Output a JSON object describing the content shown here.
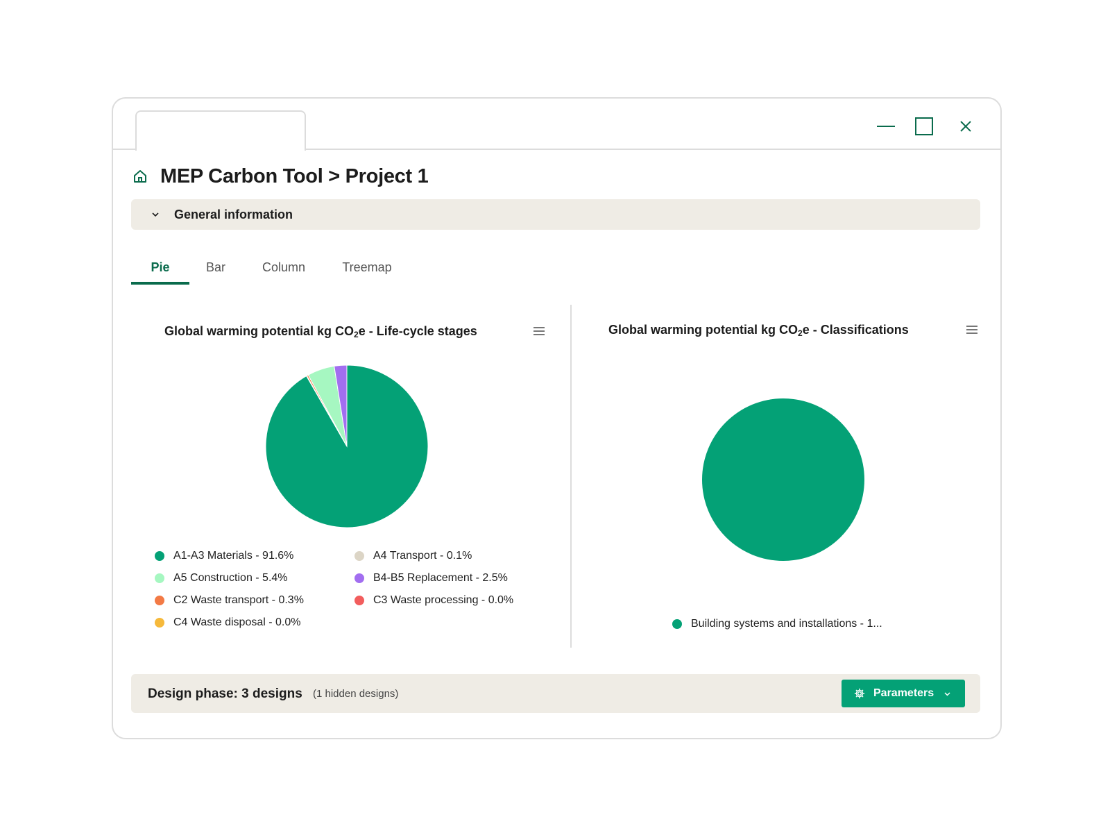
{
  "header": {
    "breadcrumb_title": "MEP Carbon Tool > Project 1"
  },
  "general_section": {
    "label": "General information",
    "expanded": false
  },
  "tabs": [
    {
      "label": "Pie",
      "active": true
    },
    {
      "label": "Bar",
      "active": false
    },
    {
      "label": "Column",
      "active": false
    },
    {
      "label": "Treemap",
      "active": false
    }
  ],
  "charts": {
    "left": {
      "title_prefix": "Global warming potential kg CO",
      "title_sub": "2",
      "title_suffix": "e - Life-cycle stages"
    },
    "right": {
      "title_prefix": "Global warming potential kg CO",
      "title_sub": "2",
      "title_suffix": "e - Classifications"
    }
  },
  "chart_data": [
    {
      "type": "pie",
      "title": "Global warming potential kg CO2e - Life-cycle stages",
      "legend_position": "bottom",
      "slices": [
        {
          "label": "A1-A3 Materials - 91.6%",
          "name": "A1-A3 Materials",
          "value": 91.6,
          "color": "#04a176"
        },
        {
          "label": "A4 Transport - 0.1%",
          "name": "A4 Transport",
          "value": 0.1,
          "color": "#dcd5c6"
        },
        {
          "label": "A5 Construction - 5.4%",
          "name": "A5 Construction",
          "value": 5.4,
          "color": "#a6f7c1"
        },
        {
          "label": "B4-B5 Replacement - 2.5%",
          "name": "B4-B5 Replacement",
          "value": 2.5,
          "color": "#a26ef0"
        },
        {
          "label": "C2 Waste transport - 0.3%",
          "name": "C2 Waste transport",
          "value": 0.3,
          "color": "#f37a45"
        },
        {
          "label": "C3 Waste processing - 0.0%",
          "name": "C3 Waste processing",
          "value": 0.0,
          "color": "#f25d5d"
        },
        {
          "label": "C4 Waste disposal - 0.0%",
          "name": "C4 Waste disposal",
          "value": 0.0,
          "color": "#f6b93b"
        }
      ]
    },
    {
      "type": "pie",
      "title": "Global warming potential kg CO2e - Classifications",
      "legend_position": "bottom",
      "slices": [
        {
          "label": "Building systems and installations - 1...",
          "value": 100,
          "color": "#04a176"
        }
      ]
    }
  ],
  "footer": {
    "title": "Design phase: 3 designs",
    "subtitle": "(1 hidden designs)",
    "parameters_button": "Parameters"
  },
  "colors": {
    "accent": "#04a176",
    "dark_green": "#0a6b4c",
    "panel_bg": "#efece5"
  },
  "icons": [
    "home-icon",
    "chevron-down-icon",
    "minimize-icon",
    "maximize-icon",
    "close-icon",
    "menu-icon",
    "gear-icon"
  ]
}
